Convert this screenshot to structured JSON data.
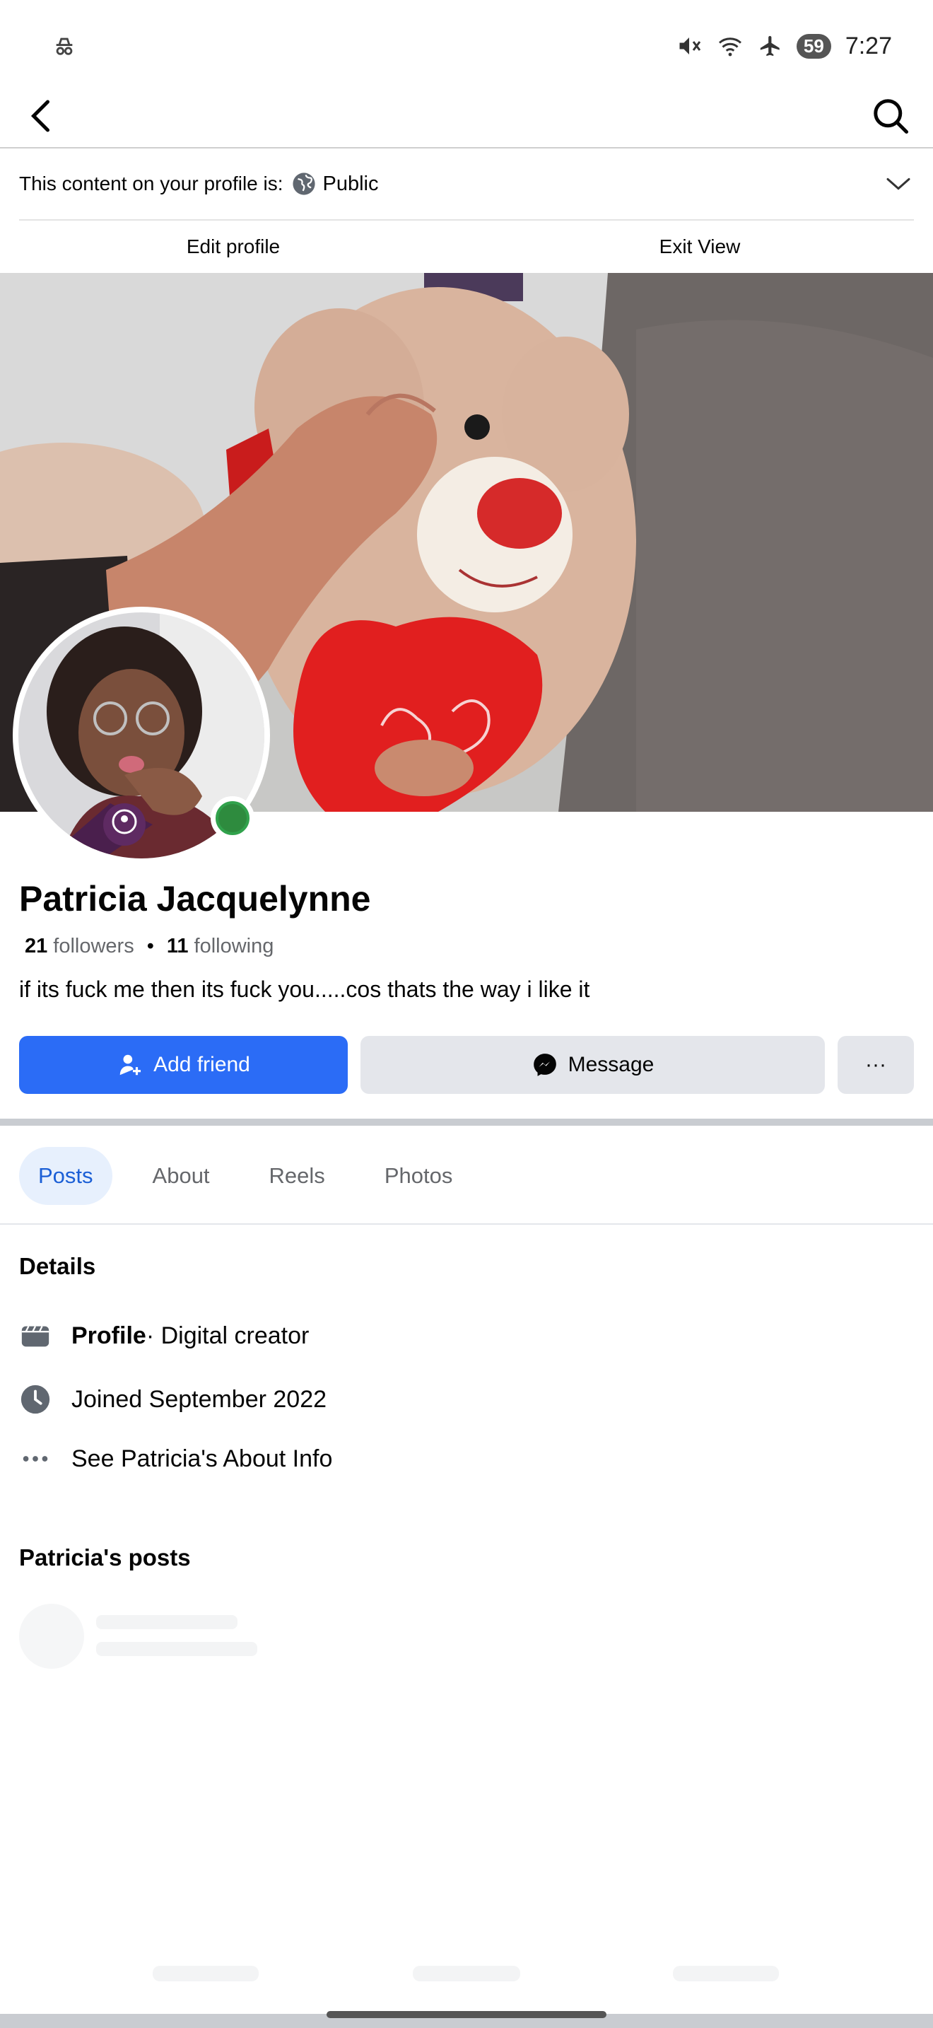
{
  "status_bar": {
    "time": "7:27",
    "battery": "59",
    "icons": [
      "incognito-icon",
      "mute-icon",
      "wifi-icon",
      "airplane-icon",
      "battery-icon"
    ]
  },
  "header": {
    "back_icon": "chevron-left-icon",
    "search_icon": "search-icon"
  },
  "privacy": {
    "label": "This content on your profile is:",
    "value": "Public",
    "icon": "globe-icon"
  },
  "view_tabs": {
    "edit_profile": "Edit profile",
    "exit_view": "Exit View"
  },
  "profile": {
    "name": "Patricia Jacquelynne",
    "followers_count": "21",
    "followers_label": "followers",
    "separator": "•",
    "following_count": "11",
    "following_label": "following",
    "bio": "if its fuck me then its fuck you.....cos thats the way i like it",
    "online": true
  },
  "actions": {
    "add_friend": "Add friend",
    "message": "Message",
    "more": "···"
  },
  "tabs": [
    {
      "label": "Posts",
      "active": true
    },
    {
      "label": "About",
      "active": false
    },
    {
      "label": "Reels",
      "active": false
    },
    {
      "label": "Photos",
      "active": false
    }
  ],
  "details": {
    "title": "Details",
    "profile_label": "Profile",
    "profile_category": " · Digital creator",
    "joined": "Joined September 2022",
    "about_link": "See Patricia's About Info"
  },
  "posts": {
    "title": "Patricia's posts"
  },
  "colors": {
    "primary": "#2b6cf6",
    "tab_active_bg": "#e7f0fd",
    "tab_active_text": "#1b5fd6",
    "secondary_button": "#e4e6eb",
    "online": "#31a24c"
  }
}
